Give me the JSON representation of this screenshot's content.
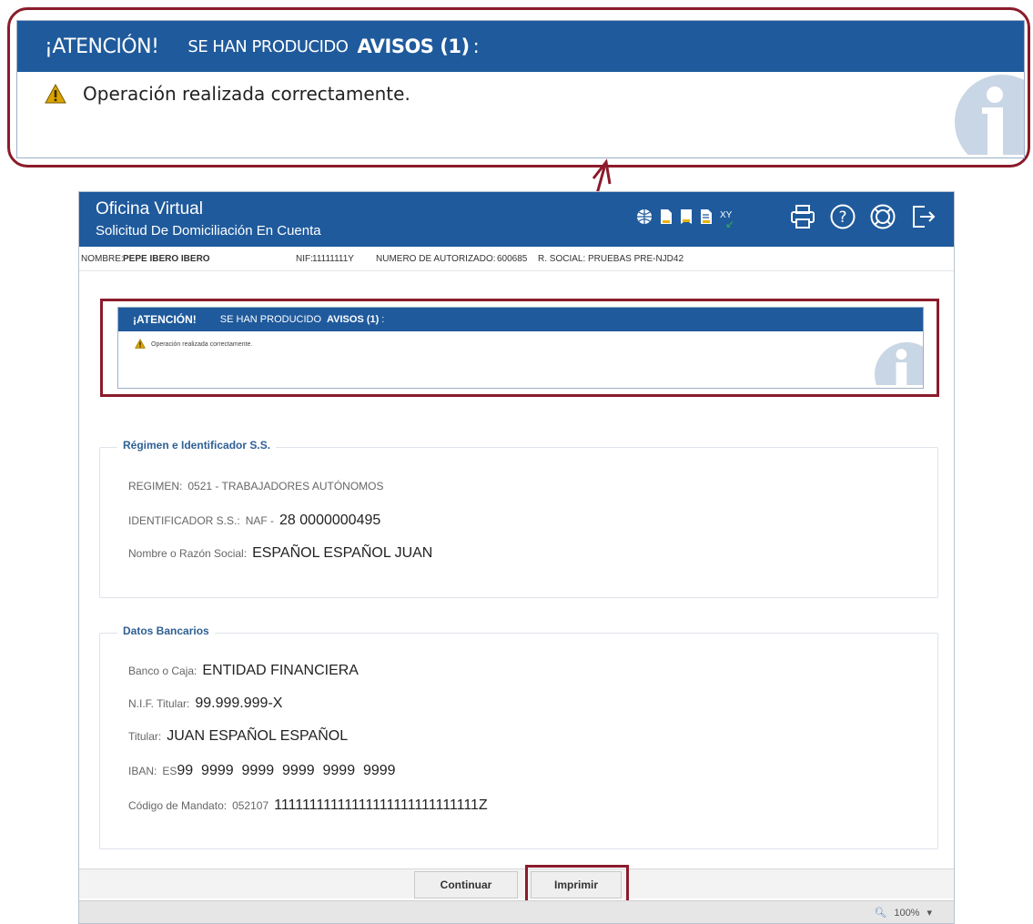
{
  "notice": {
    "attention": "¡ATENCIÓN!",
    "produced": "SE HAN PRODUCIDO",
    "warnings": "AVISOS (1)",
    "colon": ":",
    "message": "Operación realizada correctamente."
  },
  "header": {
    "title": "Oficina Virtual",
    "subtitle": "Solicitud De Domiciliación En Cuenta",
    "xy_label": "XY"
  },
  "user": {
    "name_label": "NOMBRE:",
    "name_value": "PEPE IBERO IBERO",
    "nif_label": "NIF:",
    "nif_value": "11111111Y",
    "auth_label": "NUMERO DE AUTORIZADO:",
    "auth_value": "600685",
    "social_label": "R. SOCIAL:",
    "social_value": "PRUEBAS PRE-NJD42"
  },
  "regimen": {
    "legend": "Régimen e Identificador S.S.",
    "regimen_label": "REGIMEN:",
    "regimen_value": "0521 - TRABAJADORES AUTÓNOMOS",
    "id_label": "IDENTIFICADOR S.S.:",
    "id_prefix": "NAF -",
    "id_value": "28 0000000495",
    "name_label": "Nombre o Razón Social:",
    "name_value": "ESPAÑOL ESPAÑOL JUAN"
  },
  "bank": {
    "legend": "Datos Bancarios",
    "bank_label": "Banco o Caja:",
    "bank_value": "ENTIDAD FINANCIERA",
    "nif_label": "N.I.F. Titular:",
    "nif_value": "99.999.999-X",
    "holder_label": "Titular:",
    "holder_value": "JUAN ESPAÑOL ESPAÑOL",
    "iban_label": "IBAN:",
    "iban_prefix": "ES",
    "iban_value": "99  9999  9999  9999  9999  9999",
    "mandate_label": "Código de Mandato:",
    "mandate_prefix": "052107",
    "mandate_value": "11111111111111111111111111111Z"
  },
  "buttons": {
    "continue": "Continuar",
    "print": "Imprimir"
  },
  "status": {
    "zoom": "100%",
    "zoom_dropdown": "▾"
  },
  "colors": {
    "header_blue": "#1f5a9c",
    "highlight_red": "#8b1b2b",
    "warning_yellow": "#e8b400"
  }
}
